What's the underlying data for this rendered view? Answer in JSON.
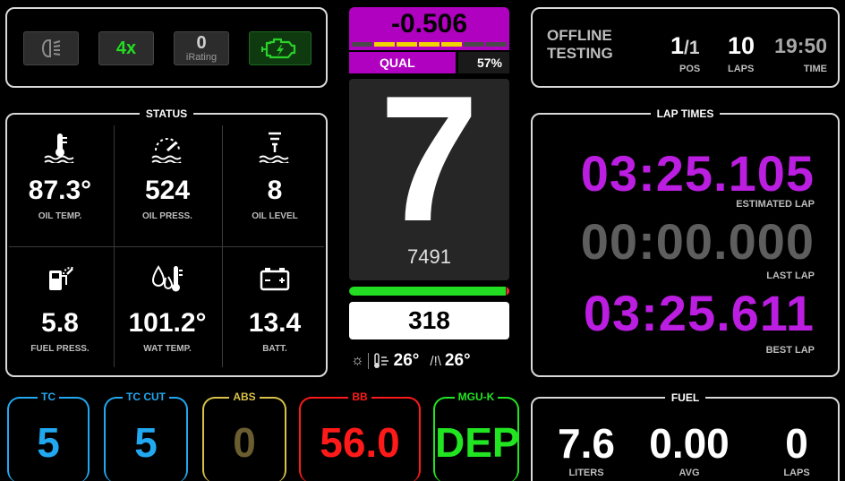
{
  "colors": {
    "accent_purple": "#b000c0",
    "lap_purple": "#bb1ee0",
    "gray_text": "#5e5e5e",
    "green": "#22dd22",
    "tc_blue": "#22a8f0",
    "abs_yellow": "#d9c24a",
    "abs_value": "#6a5d30",
    "bb_red": "#ff1a1a",
    "mguk_green": "#22e522"
  },
  "top_buttons": {
    "headlight_icon": "headlight-icon",
    "multiplier": "4x",
    "irating_value": "0",
    "irating_label": "iRating",
    "engine_icon": "engine-warning-icon"
  },
  "session": {
    "line1": "OFFLINE",
    "line2": "TESTING",
    "pos_value": "1",
    "pos_total": "/1",
    "pos_label": "POS",
    "laps_value": "10",
    "laps_label": "LAPS",
    "time_value": "19:50",
    "time_label": "TIME"
  },
  "status": {
    "title": "STATUS",
    "cells": [
      {
        "icon": "oil-temp-icon",
        "value": "87.3°",
        "label": "OIL TEMP."
      },
      {
        "icon": "oil-pressure-icon",
        "value": "524",
        "label": "OIL PRESS."
      },
      {
        "icon": "oil-level-icon",
        "value": "8",
        "label": "OIL LEVEL"
      },
      {
        "icon": "fuel-pressure-icon",
        "value": "5.8",
        "label": "FUEL PRESS."
      },
      {
        "icon": "water-temp-icon",
        "value": "101.2°",
        "label": "WAT TEMP."
      },
      {
        "icon": "battery-icon",
        "value": "13.4",
        "label": "BATT."
      }
    ]
  },
  "center": {
    "delta": "-0.506",
    "delta_segments_lit": [
      false,
      true,
      true,
      true,
      true,
      false,
      false
    ],
    "session_type": "QUAL",
    "percent": "57%",
    "gear": "7",
    "rpm": "7491",
    "rpm_fraction": 0.98,
    "speed": "318",
    "weather_air": "26°",
    "weather_track": "26°"
  },
  "lap_times": {
    "title": "LAP TIMES",
    "estimated": "03:25.105",
    "estimated_label": "ESTIMATED LAP",
    "last": "00:00.000",
    "last_label": "LAST LAP",
    "best": "03:25.611",
    "best_label": "BEST LAP"
  },
  "controls": {
    "tc_label": "TC",
    "tc_value": "5",
    "tccut_label": "TC CUT",
    "tccut_value": "5",
    "abs_label": "ABS",
    "abs_value": "0",
    "bb_label": "BB",
    "bb_value": "56.0",
    "mguk_label": "MGU-K",
    "mguk_value": "DEP"
  },
  "fuel": {
    "title": "FUEL",
    "liters_value": "7.6",
    "liters_label": "LITERS",
    "avg_value": "0.00",
    "avg_label": "AVG",
    "laps_value": "0",
    "laps_label": "LAPS"
  }
}
